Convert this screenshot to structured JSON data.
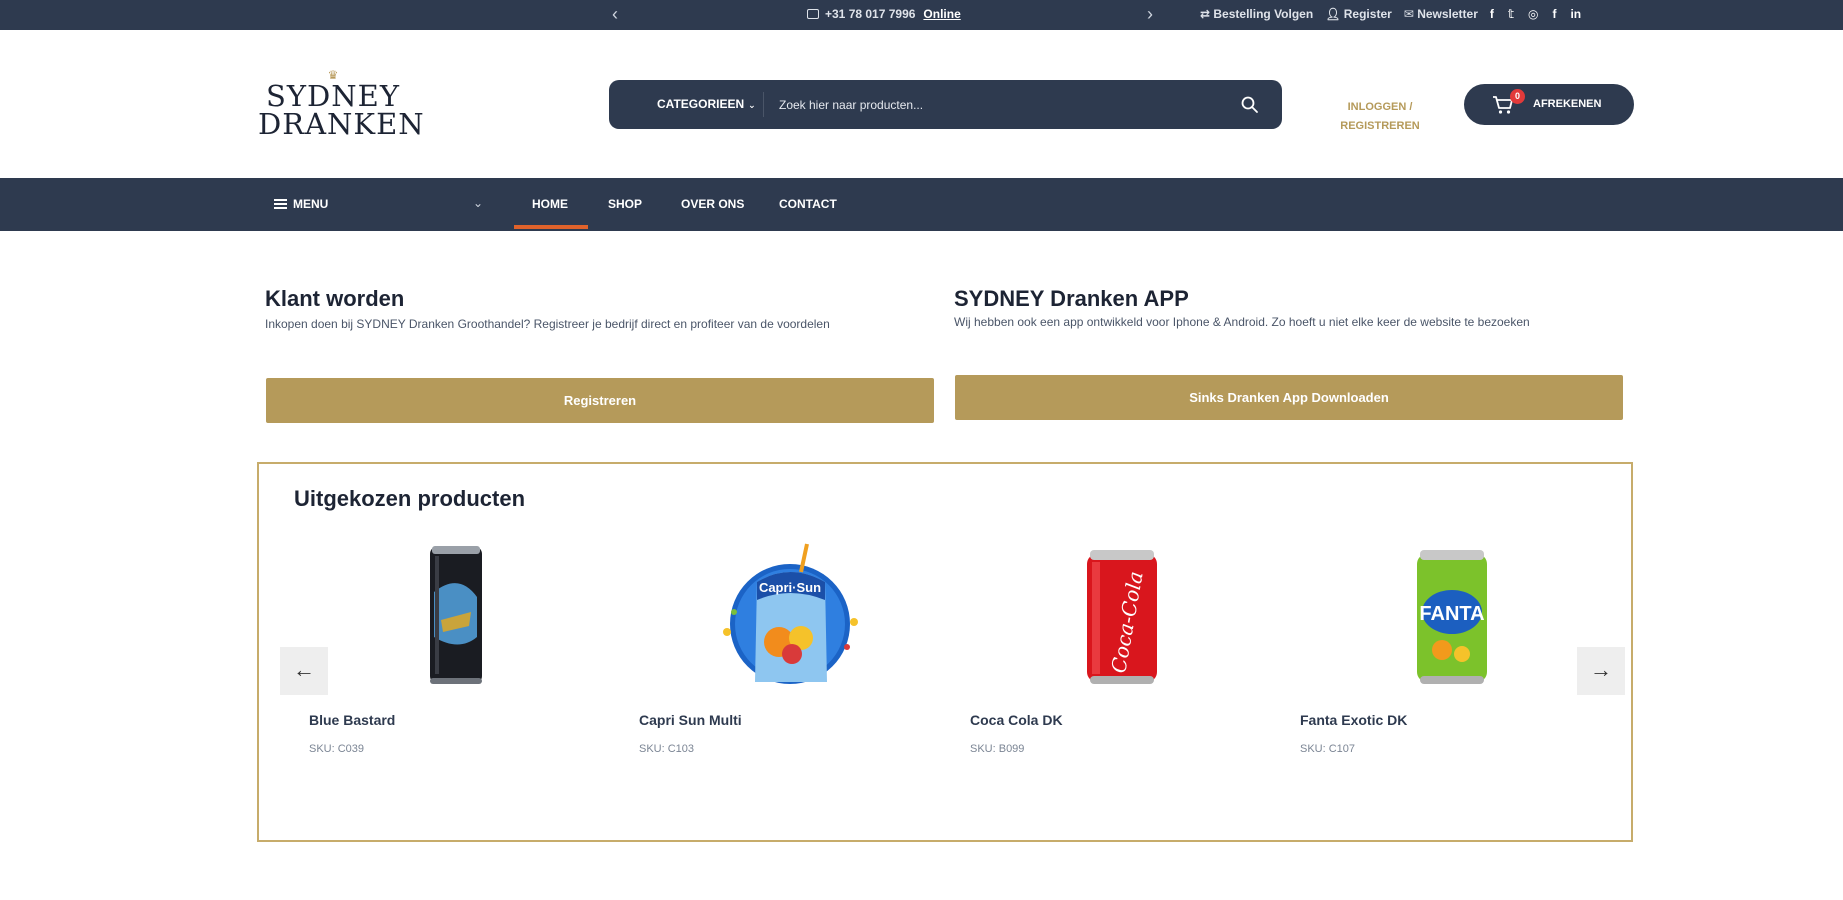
{
  "topbar": {
    "phone": "+31 78 017 7996",
    "online": "Online",
    "links": {
      "track": "Bestelling Volgen",
      "register": "Register",
      "newsletter": "Newsletter"
    },
    "social_icons": [
      "facebook-icon",
      "twitter-icon",
      "instagram-icon",
      "facebook-icon",
      "linkedin-icon"
    ]
  },
  "header": {
    "logo_line1": "SYDNEY",
    "logo_line2": "DRANKEN",
    "search": {
      "category_label": "CATEGORIEEN",
      "placeholder": "Zoek hier naar producten..."
    },
    "login_line1": "INLOGGEN /",
    "login_line2": "REGISTREREN",
    "cart": {
      "badge": "0",
      "label": "AFREKENEN"
    }
  },
  "nav": {
    "menu_label": "MENU",
    "items": [
      "HOME",
      "SHOP",
      "OVER ONS",
      "CONTACT"
    ],
    "active": "HOME"
  },
  "promo": {
    "left": {
      "title": "Klant worden",
      "text": "Inkopen doen bij SYDNEY Dranken Groothandel? Registreer je bedrijf direct en profiteer van de voordelen",
      "button": "Registreren"
    },
    "right": {
      "title": "SYDNEY Dranken APP",
      "text": "Wij hebben ook een app ontwikkeld voor Iphone & Android. Zo hoeft u niet elke keer de website te bezoeken",
      "button": "Sinks Dranken App Downloaden"
    }
  },
  "featured": {
    "title": "Uitgekozen producten",
    "products": [
      {
        "name": "Blue Bastard",
        "sku": "SKU: C039"
      },
      {
        "name": "Capri Sun Multi",
        "sku": "SKU: C103"
      },
      {
        "name": "Coca Cola DK",
        "sku": "SKU: B099"
      },
      {
        "name": "Fanta Exotic DK",
        "sku": "SKU: C107"
      }
    ]
  },
  "colors": {
    "navy": "#2e3a4f",
    "gold": "#b59a5a",
    "active_underline": "#e0622b",
    "badge_red": "#e23a3a"
  }
}
